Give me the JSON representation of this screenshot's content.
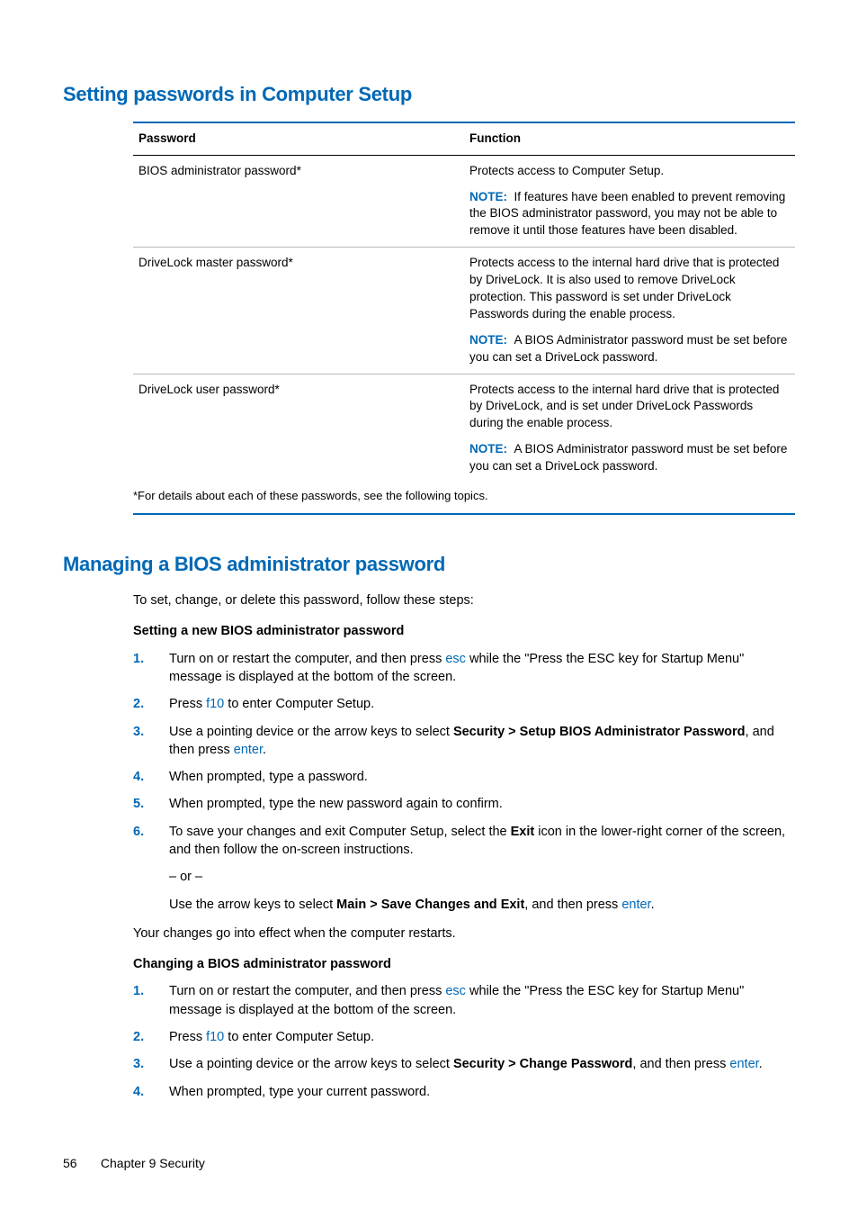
{
  "headings": {
    "h1": "Setting passwords in Computer Setup",
    "h2": "Managing a BIOS administrator password"
  },
  "table": {
    "headers": {
      "col1": "Password",
      "col2": "Function"
    },
    "rows": [
      {
        "pw": "BIOS administrator password*",
        "fn1": "Protects access to Computer Setup.",
        "noteLabel": "NOTE:",
        "note": "If features have been enabled to prevent removing the BIOS administrator password, you may not be able to remove it until those features have been disabled."
      },
      {
        "pw": "DriveLock master password*",
        "fn1": "Protects access to the internal hard drive that is protected by DriveLock. It is also used to remove DriveLock protection. This password is set under DriveLock Passwords during the enable process.",
        "noteLabel": "NOTE:",
        "note": "A BIOS Administrator password must be set before you can set a DriveLock password."
      },
      {
        "pw": "DriveLock user password*",
        "fn1": "Protects access to the internal hard drive that is protected by DriveLock, and is set under DriveLock Passwords during the enable process.",
        "noteLabel": "NOTE:",
        "note": "A BIOS Administrator password must be set before you can set a DriveLock password."
      }
    ],
    "footnote": "*For details about each of these passwords, see the following topics."
  },
  "intro2": "To set, change, or delete this password, follow these steps:",
  "set": {
    "head": "Setting a new BIOS administrator password",
    "s1a": "Turn on or restart the computer, and then press ",
    "s1key": "esc",
    "s1b": " while the \"Press the ESC key for Startup Menu\" message is displayed at the bottom of the screen.",
    "s2a": "Press ",
    "s2key": "f10",
    "s2b": " to enter Computer Setup.",
    "s3a": "Use a pointing device or the arrow keys to select ",
    "s3bold": "Security > Setup BIOS Administrator Password",
    "s3b": ", and then press ",
    "s3key": "enter",
    "s3c": ".",
    "s4": "When prompted, type a password.",
    "s5": "When prompted, type the new password again to confirm.",
    "s6a": "To save your changes and exit Computer Setup, select the ",
    "s6bold": "Exit",
    "s6b": " icon in the lower-right corner of the screen, and then follow the on-screen instructions.",
    "s6or": "– or –",
    "s6c": "Use the arrow keys to select ",
    "s6bold2": "Main > Save Changes and Exit",
    "s6d": ", and then press ",
    "s6key": "enter",
    "s6e": ".",
    "after": "Your changes go into effect when the computer restarts."
  },
  "chg": {
    "head": "Changing a BIOS administrator password",
    "s1a": "Turn on or restart the computer, and then press ",
    "s1key": "esc",
    "s1b": " while the \"Press the ESC key for Startup Menu\" message is displayed at the bottom of the screen.",
    "s2a": "Press ",
    "s2key": "f10",
    "s2b": " to enter Computer Setup.",
    "s3a": "Use a pointing device or the arrow keys to select ",
    "s3bold": "Security > Change Password",
    "s3b": ", and then press ",
    "s3key": "enter",
    "s3c": ".",
    "s4": "When prompted, type your current password."
  },
  "footer": {
    "page": "56",
    "chapter": "Chapter 9   Security"
  },
  "nums": {
    "n1": "1.",
    "n2": "2.",
    "n3": "3.",
    "n4": "4.",
    "n5": "5.",
    "n6": "6."
  }
}
